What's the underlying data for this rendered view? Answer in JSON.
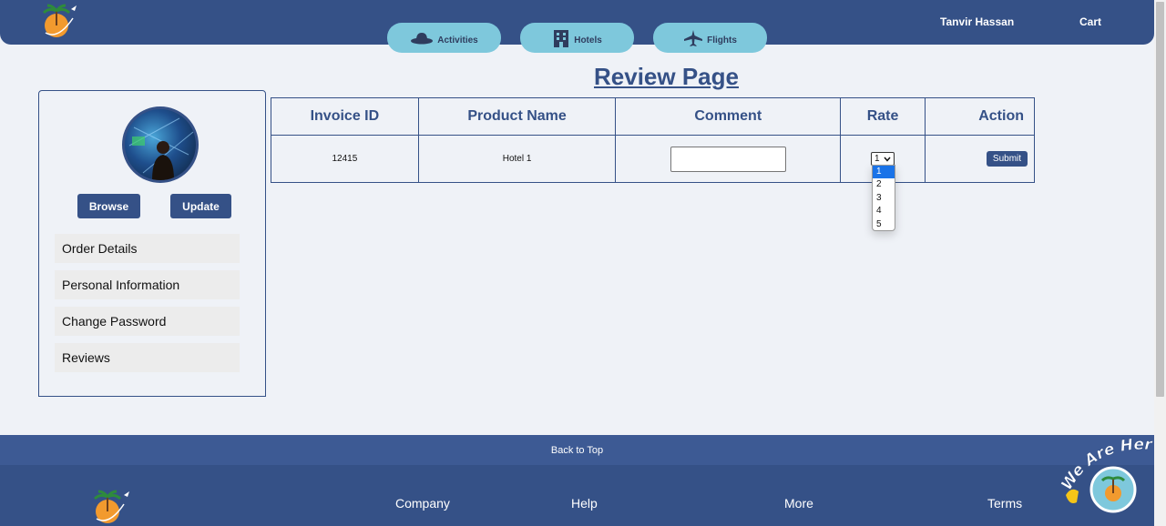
{
  "header": {
    "logo_icon": "palm-plane-logo",
    "nav": [
      {
        "label": "Activities",
        "icon": "hat-icon"
      },
      {
        "label": "Hotels",
        "icon": "building-icon"
      },
      {
        "label": "Flights",
        "icon": "airplane-icon"
      }
    ],
    "user_name": "Tanvir Hassan",
    "cart_label": "Cart"
  },
  "page_title": "Review Page",
  "sidebar": {
    "browse_label": "Browse",
    "update_label": "Update",
    "items": [
      {
        "label": "Order Details"
      },
      {
        "label": "Personal Information"
      },
      {
        "label": "Change Password"
      },
      {
        "label": "Reviews"
      }
    ]
  },
  "table": {
    "headers": [
      "Invoice ID",
      "Product Name",
      "Comment",
      "Rate",
      "Action"
    ],
    "rows": [
      {
        "invoice_id": "12415",
        "product_name": "Hotel 1",
        "comment": "",
        "rate": "1",
        "action_label": "Submit"
      }
    ]
  },
  "rate_dropdown": {
    "options": [
      "1",
      "2",
      "3",
      "4",
      "5"
    ],
    "selected": "1"
  },
  "footer": {
    "back_to_top": "Back to Top",
    "links": [
      "Company",
      "Help",
      "More",
      "Terms"
    ],
    "badge_text": "We Are Here!"
  },
  "colors": {
    "primary": "#355187",
    "nav_pill": "#7ec8dc",
    "background": "#eff2f7"
  }
}
